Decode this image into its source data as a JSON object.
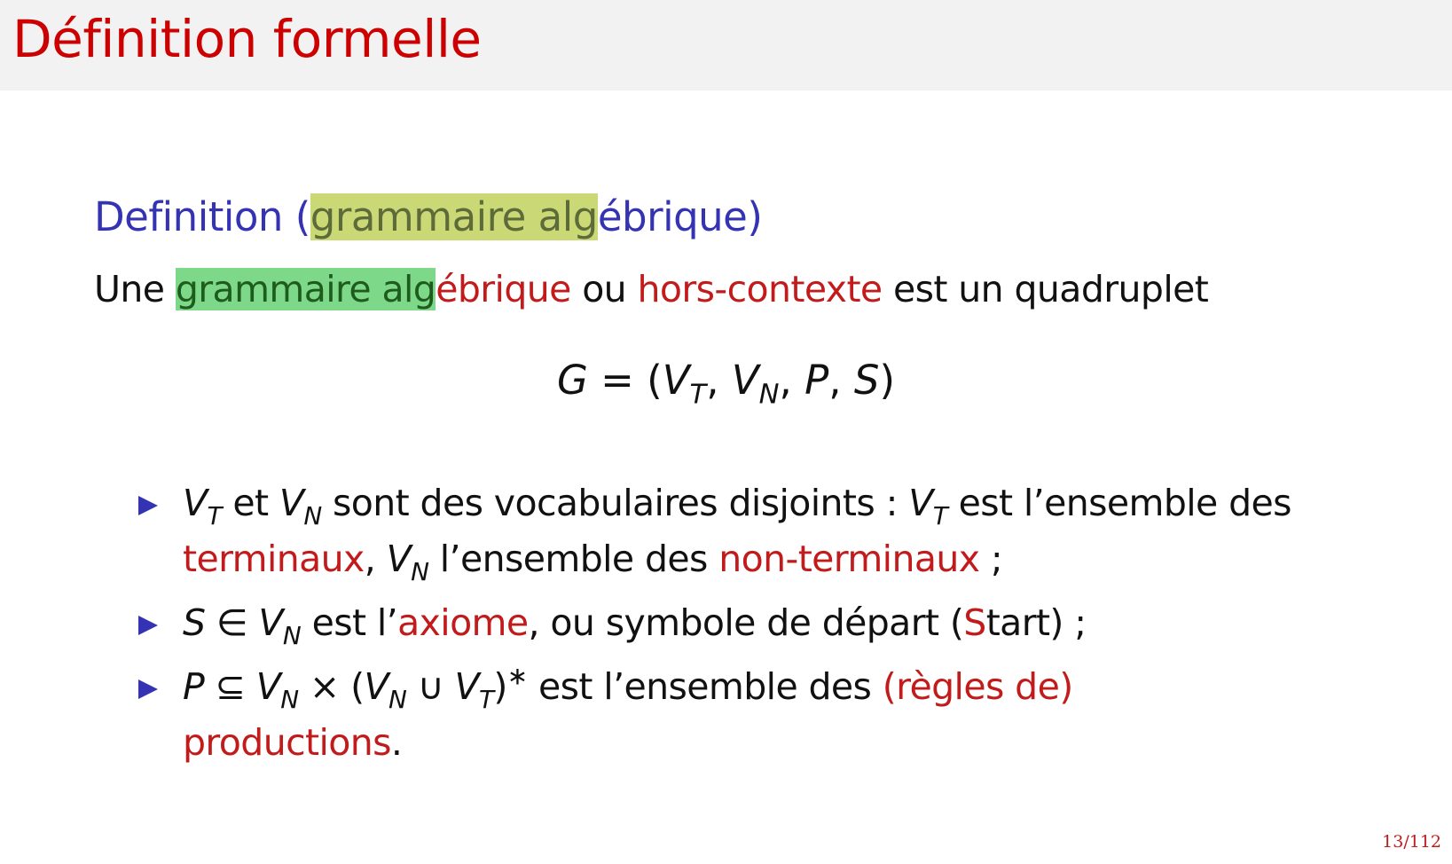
{
  "slide": {
    "title": "Définition formelle",
    "page_number": "13/112"
  },
  "definition": {
    "label": "Definition (",
    "term_highlight": "grammaire alg",
    "term_rest": "ébrique",
    "close_paren": ")"
  },
  "body": {
    "lead": "Une ",
    "term_highlight": "grammaire alg",
    "term_rest": "ébrique",
    "or": " ou ",
    "alt_term": "hors-contexte",
    "tail": " est un quadruplet"
  },
  "formula": {
    "G": "G",
    "eq_open": " = (",
    "V1": "V",
    "T1": "T",
    "comma1": ", ",
    "V2": "V",
    "N2": "N",
    "comma2": ", ",
    "P": "P",
    "comma3": ", ",
    "S": "S",
    "close": ")"
  },
  "bullets": {
    "b1": {
      "v1": "V",
      "s1": "T",
      "t1": " et ",
      "v2": "V",
      "s2": "N",
      "t2": " sont des vocabulaires disjoints : ",
      "v3": "V",
      "s3": "T",
      "t3": " est l’ensemble des ",
      "term1": "terminaux",
      "t4": ", ",
      "v4": "V",
      "s4": "N",
      "t5": " l’ensemble des ",
      "term2": "non-terminaux",
      "t6": " ;"
    },
    "b2": {
      "S": "S",
      "in": " ∈ ",
      "v": "V",
      "s": "N",
      "t1": " est l’",
      "term": "axiome",
      "t2": ", ou symbole de départ (",
      "start_S": "S",
      "start_rest": "tart) ;"
    },
    "b3": {
      "P": "P",
      "subset": " ⊆ ",
      "v1": "V",
      "s1": "N",
      "times": " × (",
      "v2": "V",
      "s2": "N",
      "cup": " ∪ ",
      "v3": "V",
      "s3": "T",
      "close": ")",
      "star": "∗",
      "t1": " est l’ensemble des ",
      "term1": "(règles de)",
      "term2": "productions",
      "period": "."
    }
  },
  "colors": {
    "title": "#cc0000",
    "definition_title": "#3333b3",
    "emphasis": "#c11b1b",
    "highlight_title": "#cad975",
    "highlight_body": "#7ed88a",
    "bullet": "#3333b3"
  }
}
